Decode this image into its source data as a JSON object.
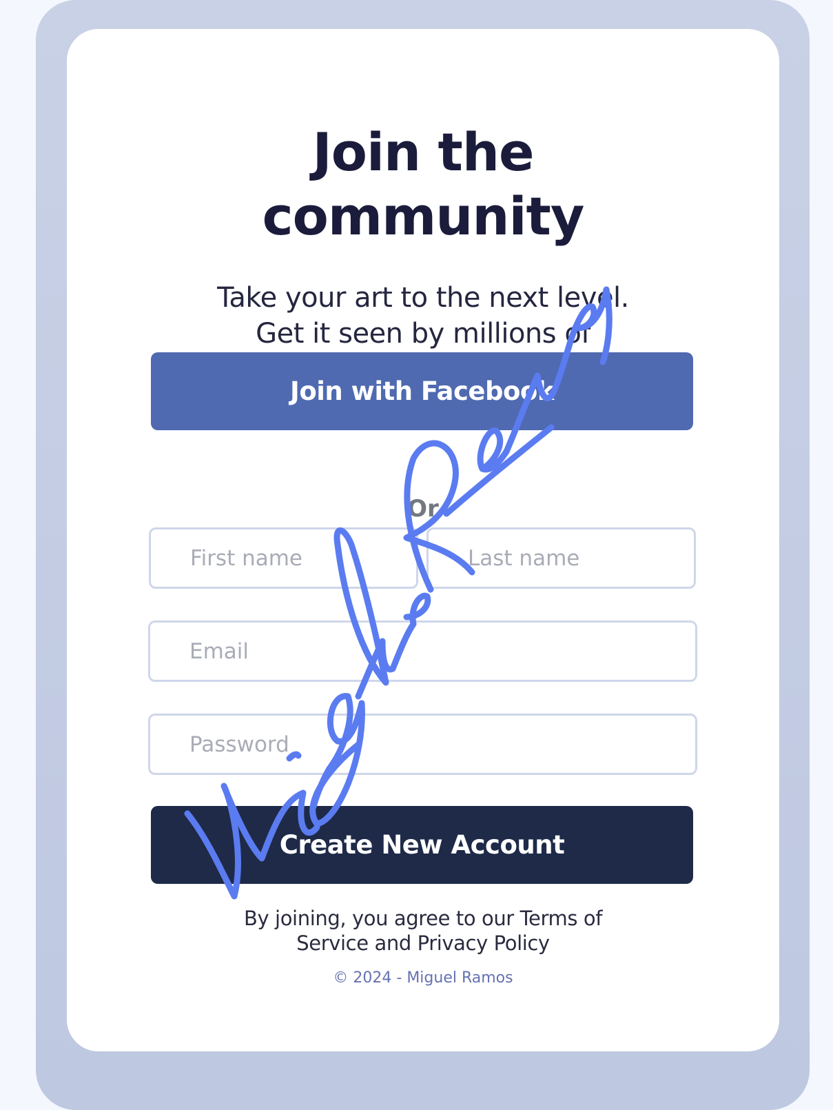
{
  "signup": {
    "title_line1": "Join the",
    "title_line2": "community",
    "subtitle": "Take your art to the next level. Get it seen by millions of people.",
    "facebook_button_label": "Join with Facebook",
    "divider_label": "Or",
    "fields": {
      "first_name_placeholder": "First name",
      "last_name_placeholder": "Last name",
      "email_placeholder": "Email",
      "password_placeholder": "Password"
    },
    "create_button_label": "Create New Account",
    "terms_text": "By joining, you agree to our Terms of Service and Privacy Policy",
    "copyright": "© 2024 - Miguel Ramos"
  },
  "signature": {
    "text": "Miguel Ramos",
    "color": "#5b7cf0"
  },
  "colors": {
    "page_background": "#f4f7fd",
    "frame": "#c4cde4",
    "card": "#ffffff",
    "title": "#1b1c3b",
    "facebook_button": "#4f6ab0",
    "create_button": "#1e2a48",
    "input_border": "#cfd6ea",
    "copyright_text": "#6672b0"
  }
}
